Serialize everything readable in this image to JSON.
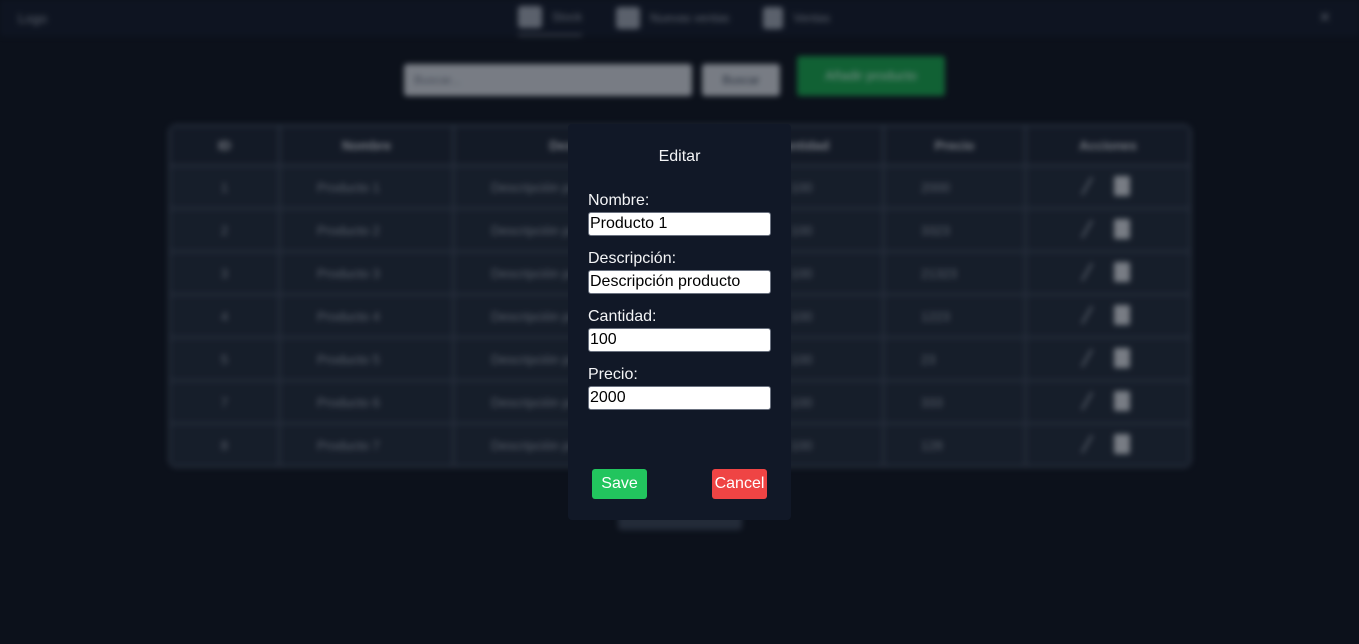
{
  "navbar": {
    "logo": "Logo",
    "items": [
      {
        "label": "Stock",
        "icon": "box-icon"
      },
      {
        "label": "Nuevas ventas",
        "icon": "cart-icon"
      },
      {
        "label": "Ventas",
        "icon": "receipt-icon"
      }
    ],
    "close": "✕"
  },
  "toolbar": {
    "search_placeholder": "Buscar...",
    "search_button": "Buscar",
    "add_button": "Añadir producto"
  },
  "table": {
    "headers": [
      "ID",
      "Nombre",
      "Descripción",
      "Cantidad",
      "Precio",
      "Acciones"
    ],
    "rows": [
      [
        "1",
        "Producto 1",
        "Descripción producto",
        "100",
        "2000"
      ],
      [
        "2",
        "Producto 2",
        "Descripción producto",
        "100",
        "3323"
      ],
      [
        "3",
        "Producto 3",
        "Descripción producto",
        "100",
        "21323"
      ],
      [
        "4",
        "Producto 4",
        "Descripción producto",
        "100",
        "1223"
      ],
      [
        "5",
        "Producto 5",
        "Descripción producto",
        "100",
        "23"
      ],
      [
        "7",
        "Producto 6",
        "Descripción producto",
        "100",
        "333"
      ],
      [
        "8",
        "Producto 7",
        "Descripción producto",
        "100",
        "128"
      ]
    ]
  },
  "modal": {
    "title": "Editar",
    "fields": [
      {
        "label": "Nombre:",
        "value": "Producto 1"
      },
      {
        "label": "Descripción:",
        "value": "Descripción producto"
      },
      {
        "label": "Cantidad:",
        "value": "100"
      },
      {
        "label": "Precio:",
        "value": "2000"
      }
    ],
    "save": "Save",
    "cancel": "Cancel"
  },
  "colors": {
    "save": "#22c55e",
    "cancel": "#ef4444",
    "add": "#16a34a"
  }
}
